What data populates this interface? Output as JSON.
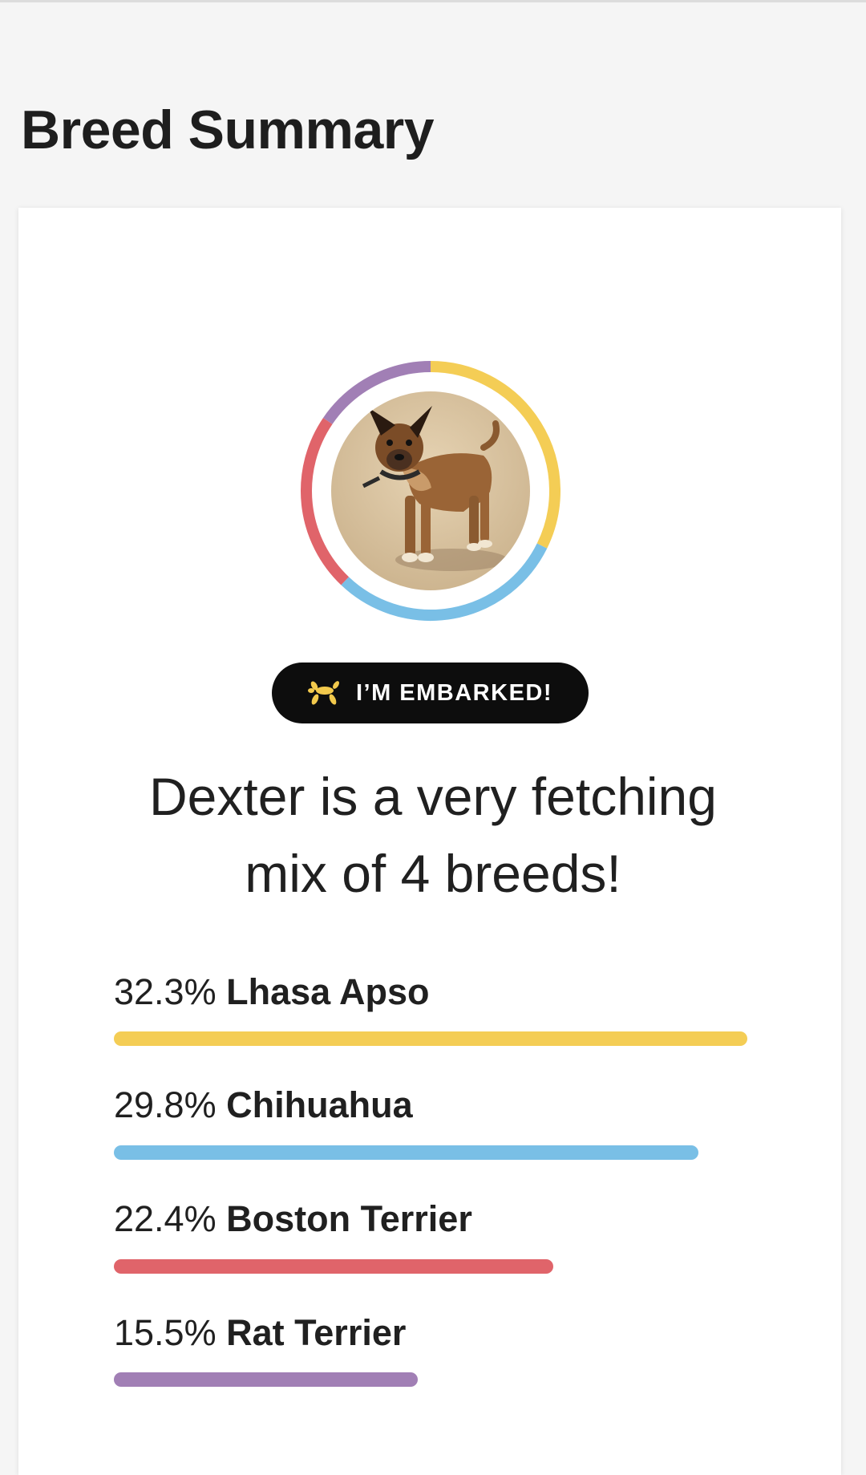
{
  "page": {
    "title": "Breed Summary"
  },
  "badge": {
    "label": "I’M EMBARKED!",
    "icon": "balloon-dog-icon",
    "icon_color": "#f2c94c"
  },
  "headline": {
    "line1": "Dexter is a very fetching",
    "line2": "mix of 4 breeds!"
  },
  "photo": {
    "subject": "dog-photo"
  },
  "breeds": [
    {
      "percent": "32.3%",
      "name": "Lhasa Apso",
      "value": 32.3,
      "color": "#f4cd55"
    },
    {
      "percent": "29.8%",
      "name": "Chihuahua",
      "value": 29.8,
      "color": "#79bfe6"
    },
    {
      "percent": "22.4%",
      "name": "Boston Terrier",
      "value": 22.4,
      "color": "#e0646a"
    },
    {
      "percent": "15.5%",
      "name": "Rat Terrier",
      "value": 15.5,
      "color": "#a17fb5"
    }
  ]
}
